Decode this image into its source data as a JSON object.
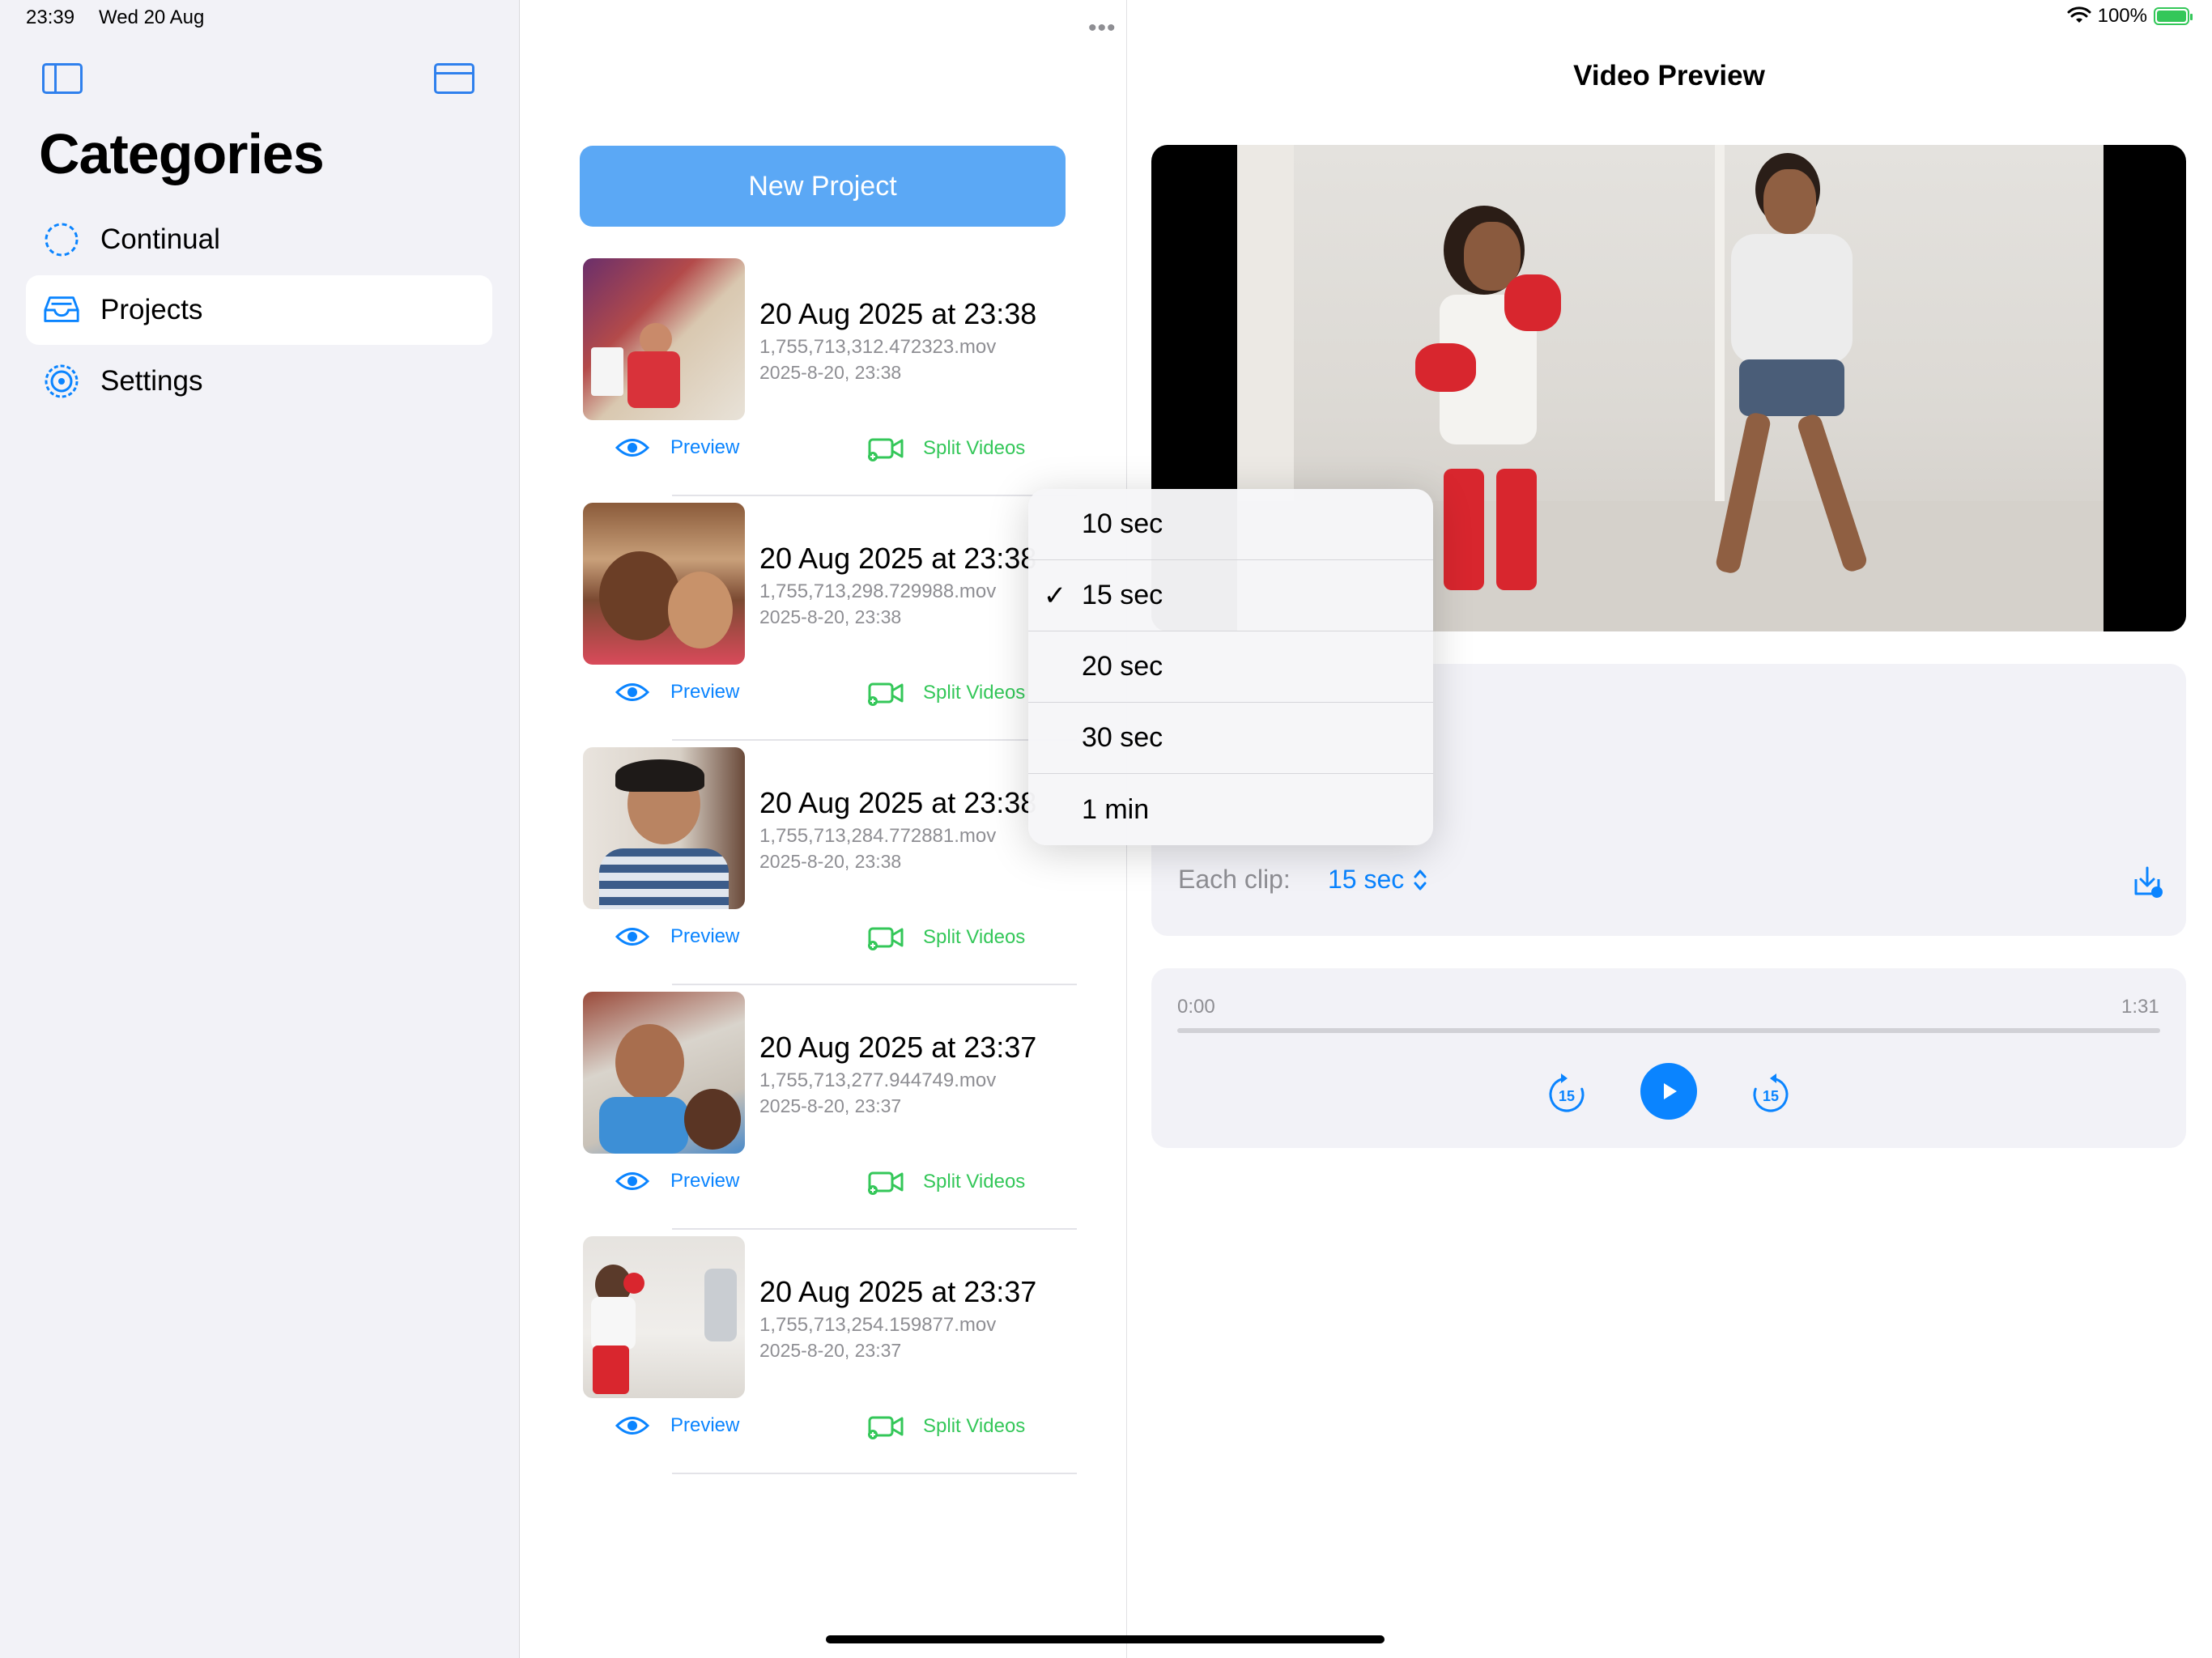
{
  "status_bar": {
    "time": "23:39",
    "date": "Wed 20 Aug",
    "battery": "100%",
    "battery_level": 1.0
  },
  "sidebar": {
    "title": "Categories",
    "items": [
      {
        "label": "Continual",
        "icon": "dashed-circle-icon"
      },
      {
        "label": "Projects",
        "icon": "tray-icon",
        "selected": true
      },
      {
        "label": "Settings",
        "icon": "gear-icon"
      }
    ]
  },
  "projects": {
    "new_project_label": "New Project",
    "items": [
      {
        "title": "20 Aug 2025 at 23:38",
        "file": "1,755,713,312.472323.mov",
        "date": "2025-8-20, 23:38",
        "preview_label": "Preview",
        "split_label": "Split Videos"
      },
      {
        "title": "20 Aug 2025 at 23:38",
        "file": "1,755,713,298.729988.mov",
        "date": "2025-8-20, 23:38",
        "preview_label": "Preview",
        "split_label": "Split Videos"
      },
      {
        "title": "20 Aug 2025 at 23:38",
        "file": "1,755,713,284.772881.mov",
        "date": "2025-8-20, 23:38",
        "preview_label": "Preview",
        "split_label": "Split Videos"
      },
      {
        "title": "20 Aug 2025 at 23:37",
        "file": "1,755,713,277.944749.mov",
        "date": "2025-8-20, 23:37",
        "preview_label": "Preview",
        "split_label": "Split Videos"
      },
      {
        "title": "20 Aug 2025 at 23:37",
        "file": "1,755,713,254.159877.mov",
        "date": "2025-8-20, 23:37",
        "preview_label": "Preview",
        "split_label": "Split Videos"
      }
    ]
  },
  "detail": {
    "title": "Video Preview",
    "each_clip_label": "Each clip:",
    "each_clip_value": "15 sec",
    "player": {
      "current_time": "0:00",
      "duration": "1:31",
      "progress": 0.0,
      "skip_seconds": "15"
    }
  },
  "clip_menu": {
    "options": [
      "10 sec",
      "15 sec",
      "20 sec",
      "30 sec",
      "1 min"
    ],
    "selected": "15 sec",
    "check_glyph": "✓"
  },
  "colors": {
    "accent": "#0a84ff",
    "success": "#34c759",
    "button_bg": "#5ba8f5",
    "secondary_bg": "#f2f2f7"
  }
}
